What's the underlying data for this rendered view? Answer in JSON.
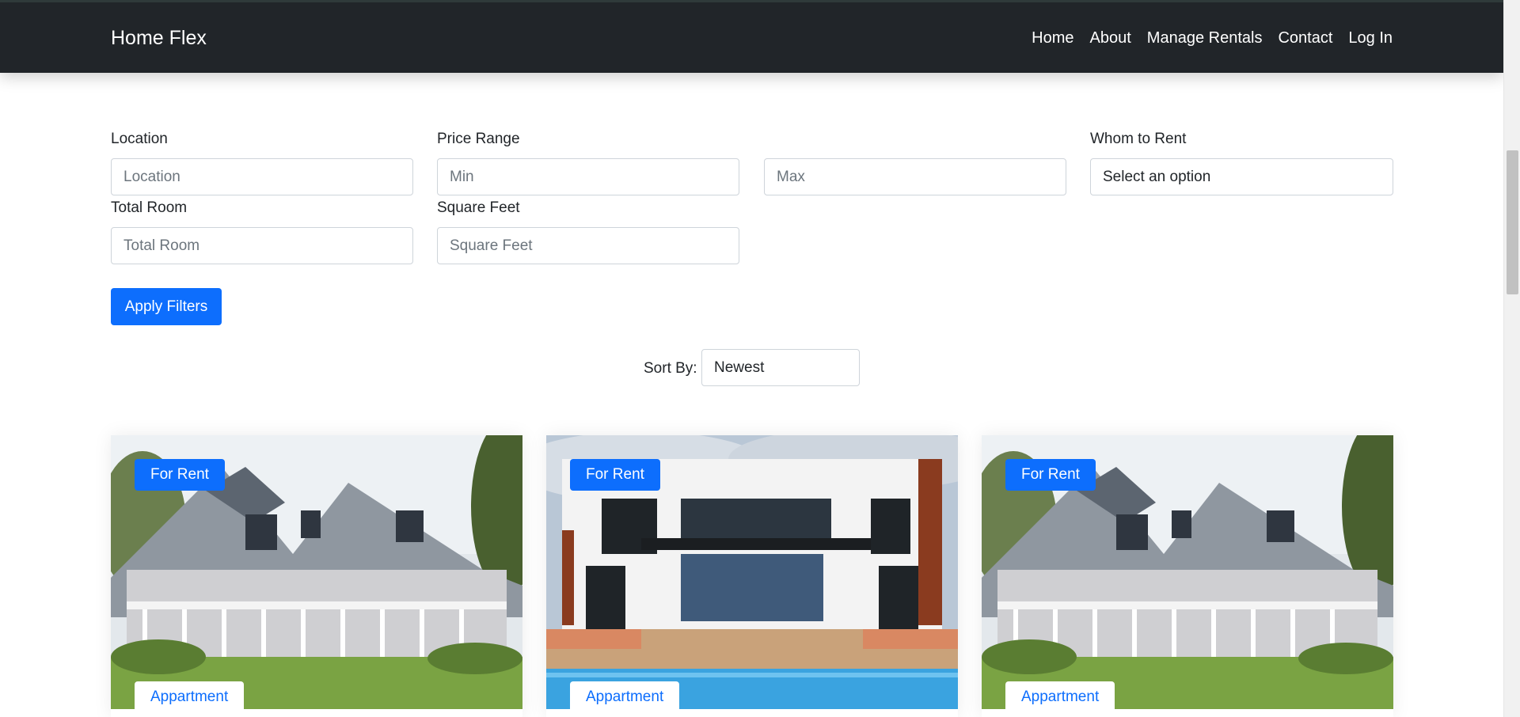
{
  "navbar": {
    "brand": "Home Flex",
    "links": [
      "Home",
      "About",
      "Manage Rentals",
      "Contact",
      "Log In"
    ]
  },
  "filters": {
    "location": {
      "label": "Location",
      "placeholder": "Location"
    },
    "price_range": {
      "label": "Price Range",
      "min_placeholder": "Min",
      "max_placeholder": "Max"
    },
    "whom_to_rent": {
      "label": "Whom to Rent",
      "value": "Select an option"
    },
    "total_room": {
      "label": "Total Room",
      "placeholder": "Total Room"
    },
    "square_feet": {
      "label": "Square Feet",
      "placeholder": "Square Feet"
    },
    "apply_label": "Apply Filters"
  },
  "sort": {
    "label": "Sort By:",
    "value": "Newest"
  },
  "listings": [
    {
      "status": "For Rent",
      "type": "Appartment",
      "image": "cottage-house-photo"
    },
    {
      "status": "For Rent",
      "type": "Appartment",
      "image": "modern-house-pool-photo"
    },
    {
      "status": "For Rent",
      "type": "Appartment",
      "image": "cottage-house-photo"
    }
  ],
  "colors": {
    "navbar": "#212529",
    "primary": "#0d6efd"
  }
}
